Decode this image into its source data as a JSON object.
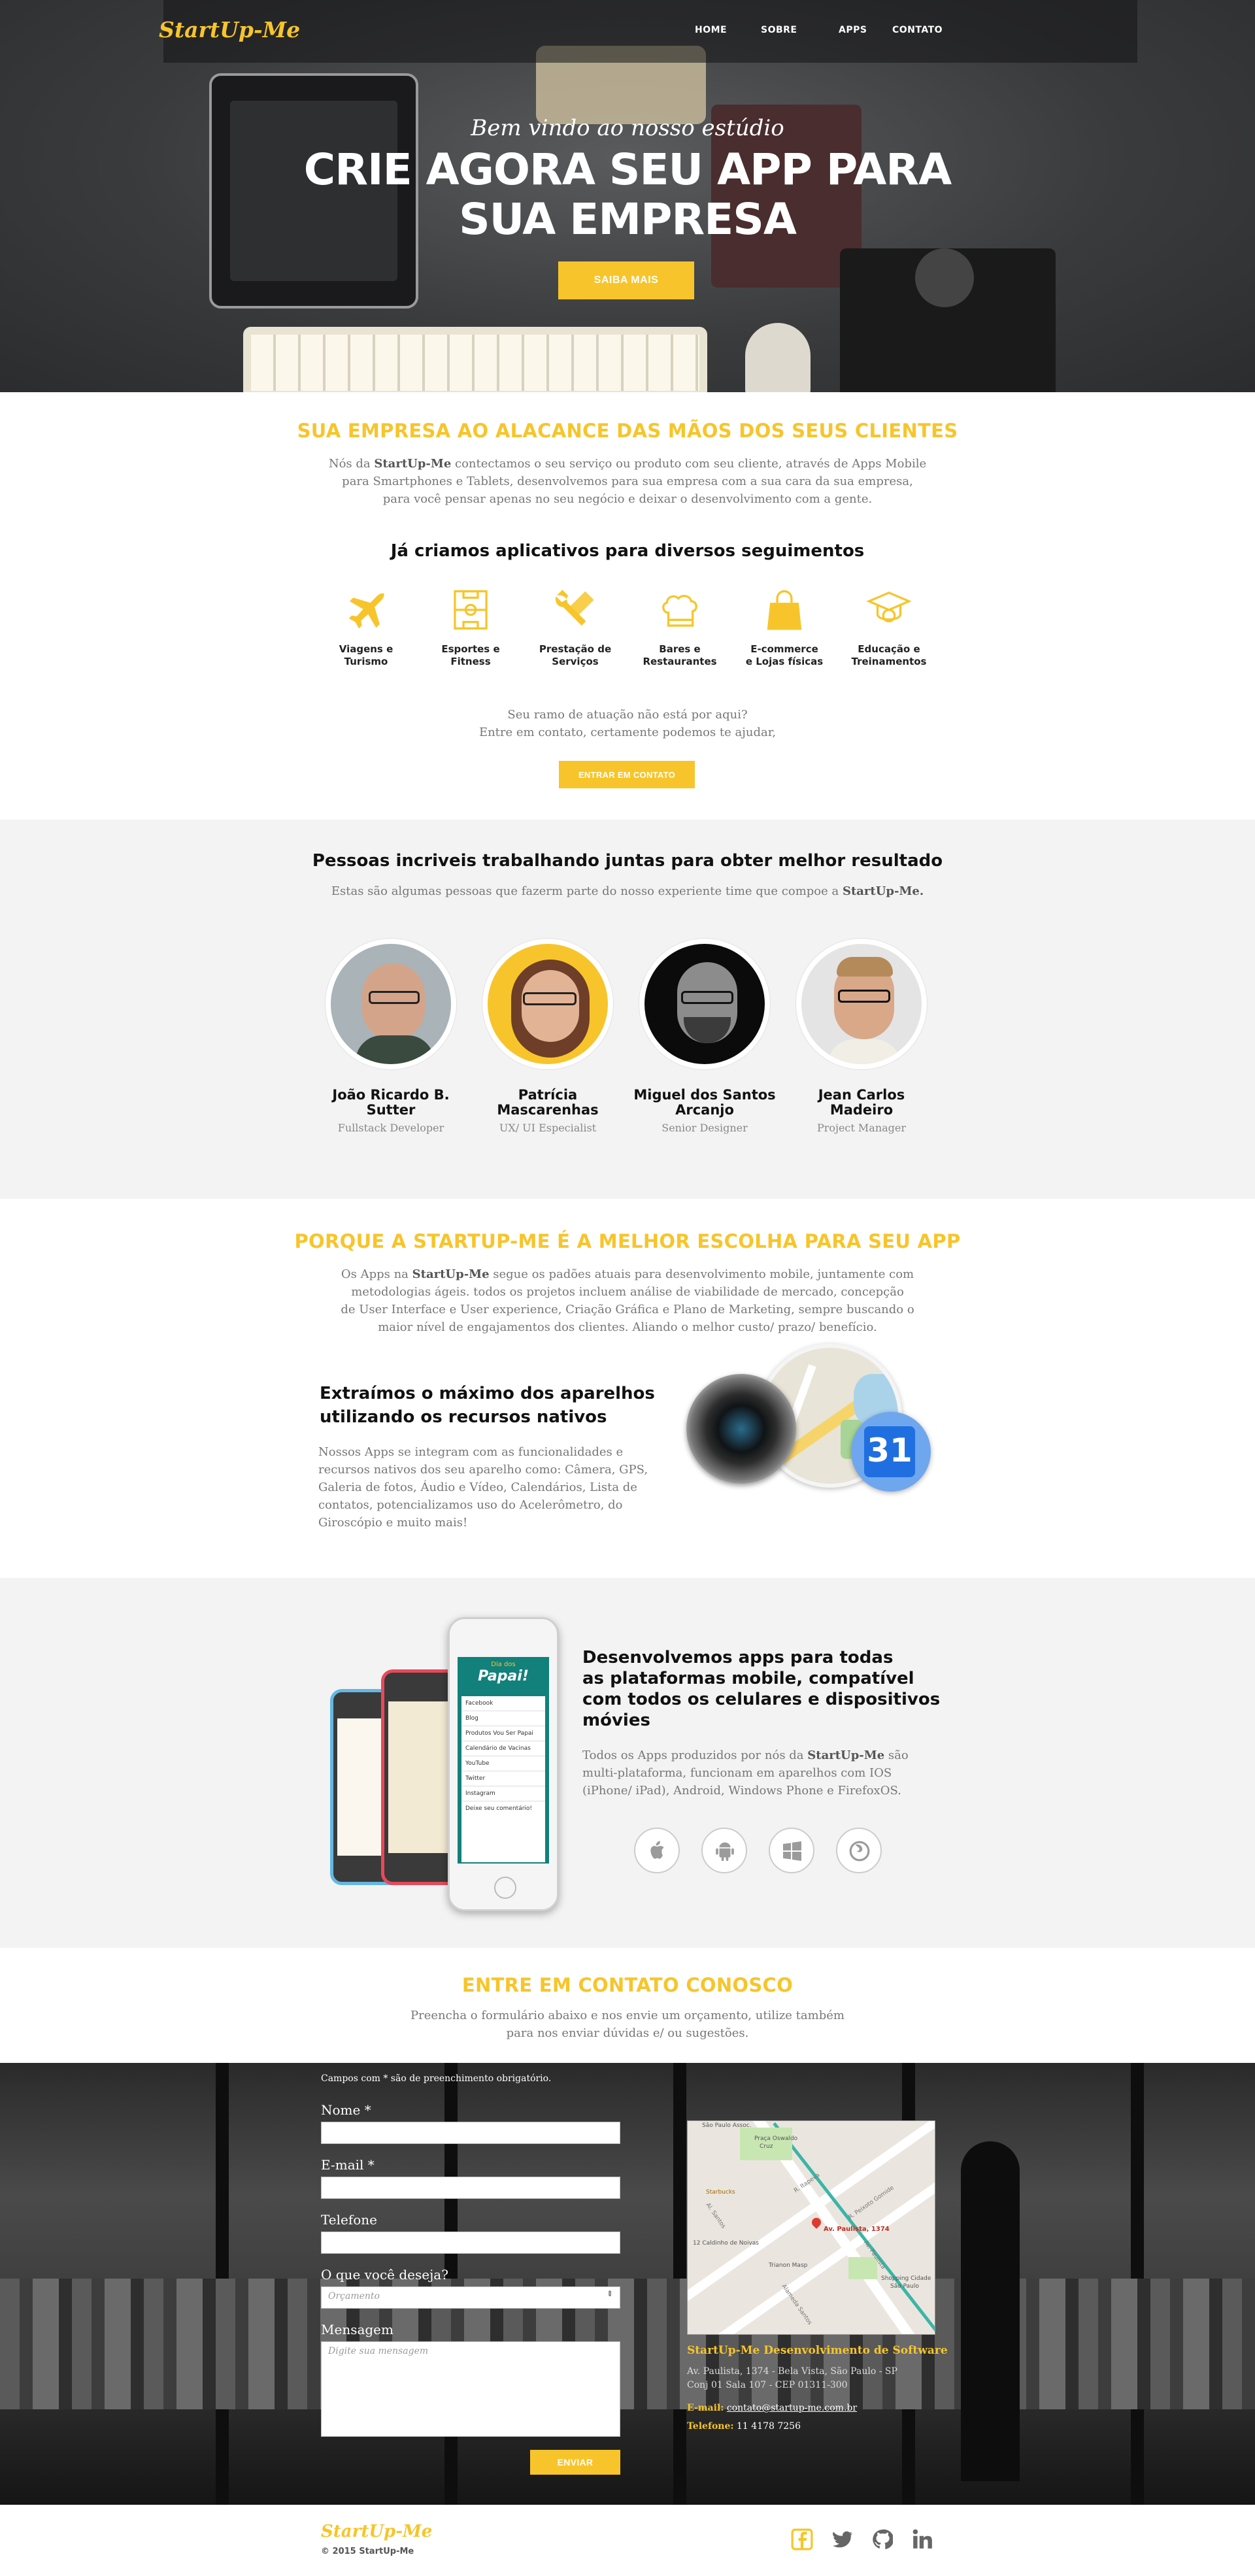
{
  "brand": {
    "logo": "StartUp-Me"
  },
  "nav": {
    "items": [
      "HOME",
      "SOBRE",
      "APPS",
      "CONTATO"
    ]
  },
  "hero": {
    "subtitle": "Bem vindo ao nosso estúdio",
    "title_line1": "CRIE AGORA SEU APP PARA",
    "title_line2": "SUA EMPRESA",
    "button": "SAIBA MAIS"
  },
  "about": {
    "title": "SUA EMPRESA AO ALACANCE DAS MÃOS DOS SEUS CLIENTES",
    "line1_pre": "Nós da ",
    "line1_brand": "StartUp-Me",
    "line1_post": " contectamos o seu serviço ou produto com seu cliente, através de Apps Mobile",
    "line2": "para Smartphones e Tablets, desenvolvemos para sua empresa com a sua cara da sua empresa,",
    "line3": "para você pensar apenas no seu negócio e deixar o desenvolvimento com a gente.",
    "subtitle": "Já criamos aplicativos para diversos seguimentos",
    "segments": [
      {
        "icon": "airplane-icon",
        "line1": "Viagens e",
        "line2": "Turismo"
      },
      {
        "icon": "sports-field-icon",
        "line1": "Esportes e",
        "line2": "Fitness"
      },
      {
        "icon": "tools-icon",
        "line1": "Prestação de",
        "line2": "Serviços"
      },
      {
        "icon": "chef-hat-icon",
        "line1": "Bares e",
        "line2": "Restaurantes"
      },
      {
        "icon": "shopping-bag-icon",
        "line1": "E-commerce",
        "line2": "e Lojas físicas"
      },
      {
        "icon": "graduation-cap-icon",
        "line1": "Educação e",
        "line2": "Treinamentos"
      }
    ],
    "cta_line1": "Seu ramo de atuação não está por aqui?",
    "cta_line2": "Entre em contato, certamente podemos te ajudar,",
    "cta_button": "ENTRAR EM CONTATO"
  },
  "team": {
    "title": "Pessoas incriveis trabalhando juntas para obter melhor resultado",
    "intro_pre": "Estas são algumas pessoas que fazerm parte do nosso experiente time que compoe a ",
    "intro_brand": "StartUp-Me.",
    "members": [
      {
        "name1": "João Ricardo B.",
        "name2": "Sutter",
        "role": "Fullstack Developer"
      },
      {
        "name1": "Patrícia",
        "name2": "Mascarenhas",
        "role": "UX/ UI Especialist"
      },
      {
        "name1": "Miguel dos Santos",
        "name2": "Arcanjo",
        "role": "Senior Designer"
      },
      {
        "name1": "Jean Carlos",
        "name2": "Madeiro",
        "role": "Project Manager"
      }
    ]
  },
  "why": {
    "title": "PORQUE A STARTUP-ME  É A MELHOR ESCOLHA PARA SEU APP",
    "line1_pre": "Os Apps na ",
    "line1_brand": "StartUp-Me",
    "line1_post": " segue os padões atuais para desenvolvimento mobile, juntamente com",
    "line2": "metodologias ágeis. todos os projetos incluem análise de viabilidade de mercado, concepção",
    "line3": "de User Interface e User experience, Criação Gráfica e Plano de Marketing, sempre buscando o",
    "line4": "maior nível de engajamentos dos clientes. Aliando o melhor custo/ prazo/ benefício.",
    "feature_title1": "Extraímos o máximo dos aparelhos",
    "feature_title2": "utilizando os recursos nativos",
    "feature_p": [
      "Nossos Apps se integram com as funcionalidades e",
      "recursos nativos dos seu aparelho como: Câmera, GPS,",
      "Galeria de fotos, Áudio e Vídeo, Calendários, Lista de",
      "contatos,  potencializamos uso do Acelerômetro, do",
      "Giroscópio e muito mais!"
    ],
    "calendar_day": "31"
  },
  "platforms": {
    "title": [
      "Desenvolvemos apps para todas",
      "as plataformas  mobile, compatível",
      "com todos os celulares e dispositivos",
      "móvies"
    ],
    "p1_pre": "Todos os Apps produzidos por nós da ",
    "p1_brand": "StartUp-Me",
    "p1_post": " são",
    "p2": "multi-plataforma, funcionam em aparelhos com IOS",
    "p3": "(iPhone/ iPad), Android, Windows Phone e FirefoxOS.",
    "icons": [
      "apple-icon",
      "android-icon",
      "windows-icon",
      "firefox-icon"
    ],
    "phone_title": "Papai!",
    "phone_small": "Dia dos",
    "phone_menu": [
      "Facebook",
      "Blog",
      "Produtos Vou Ser Papai",
      "Calendário de Vacinas",
      "YouTube",
      "Twitter",
      "Instagram",
      "Deixe seu comentário!"
    ]
  },
  "contact": {
    "title": "ENTRE EM CONTATO CONOSCO",
    "p1": "Preencha o formulário abaixo e nos envie um orçamento, utilize também",
    "p2": "para nos enviar dúvidas e/ ou sugestões.",
    "required_note": "Campos com * são de preenchimento obrigatório.",
    "labels": {
      "name": "Nome *",
      "email": "E-mail *",
      "phone": "Telefone",
      "want": "O que você deseja?",
      "message": "Mensagem"
    },
    "select_value": "Orçamento",
    "message_placeholder": "Digite sua mensagem",
    "send": "ENVIAR",
    "company": "StartUp-Me Desenvolvimento de Software",
    "address1": "Av. Paulista, 1374 - Bela Vista, São Paulo - SP",
    "address2": "Conj 01 Sala 107 - CEP 01311-300",
    "email_label": "E-mail:",
    "email": "contato@startup-me.com.br",
    "phone_label": "Telefone:",
    "phone": "11 4178 7256",
    "map": {
      "pin_label": "Av. Paulista, 1374",
      "places": [
        "São Paulo Assoc.",
        "Praça Oswaldo",
        "Cruz",
        "Starbucks",
        "12 Caldinho de Noivas",
        "Trianon Masp",
        "Shopping Cidade",
        "São Paulo",
        "Al. Santos",
        "Av. Paulista",
        "R. Itapeva",
        "R. Peixoto Gomide",
        "Alameda Santos"
      ]
    }
  },
  "footer": {
    "logo": "StartUp-Me",
    "copyright": "© 2015 StartUp-Me",
    "icons": [
      "facebook-icon",
      "twitter-icon",
      "github-icon",
      "linkedin-icon"
    ]
  },
  "colors": {
    "accent": "#f7c52b",
    "dark": "#1d1d1d",
    "light_bg": "#f3f3f3"
  }
}
